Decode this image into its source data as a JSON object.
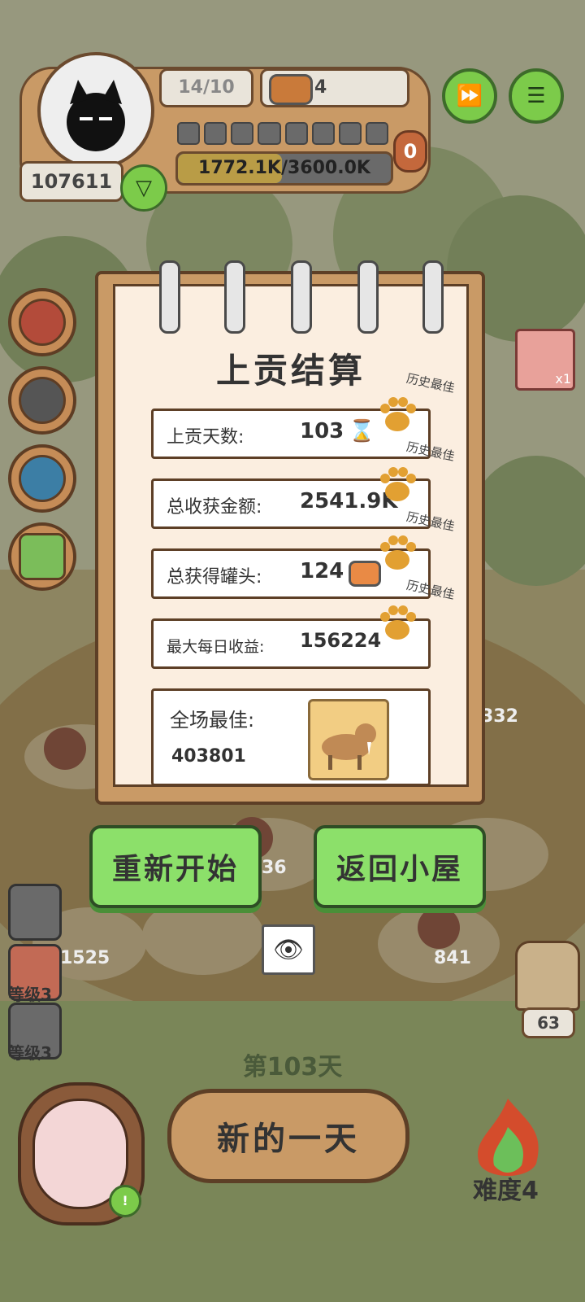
{
  "hud": {
    "days_progress": "14/10",
    "cans": "4",
    "coins": "107611",
    "money_progress": "1772.1K/3600.0K",
    "badge": "0"
  },
  "side_items": {
    "item_count": "x1"
  },
  "notebook": {
    "title": "上贡结算",
    "best_label": "历史最佳",
    "rows": [
      {
        "label": "上贡天数:",
        "value": "103"
      },
      {
        "label": "总收获金额:",
        "value": "2541.9K"
      },
      {
        "label": "总获得罐头:",
        "value": "124"
      },
      {
        "label": "最大每日收益:",
        "value": "156224"
      }
    ],
    "overall_best_label": "全场最佳:",
    "overall_best_value": "403801"
  },
  "buttons": {
    "restart": "重新开始",
    "return_home": "返回小屋",
    "new_day": "新的一天"
  },
  "board_numbers": [
    "1525",
    "36",
    "841",
    "332",
    "63"
  ],
  "left_levels": [
    "等级3",
    "等级3"
  ],
  "day_label": "第103天",
  "difficulty": "难度4",
  "colors": {
    "accent_green": "#8ce06a",
    "paper": "#fbeee0",
    "frame_brown": "#5d3f26"
  }
}
